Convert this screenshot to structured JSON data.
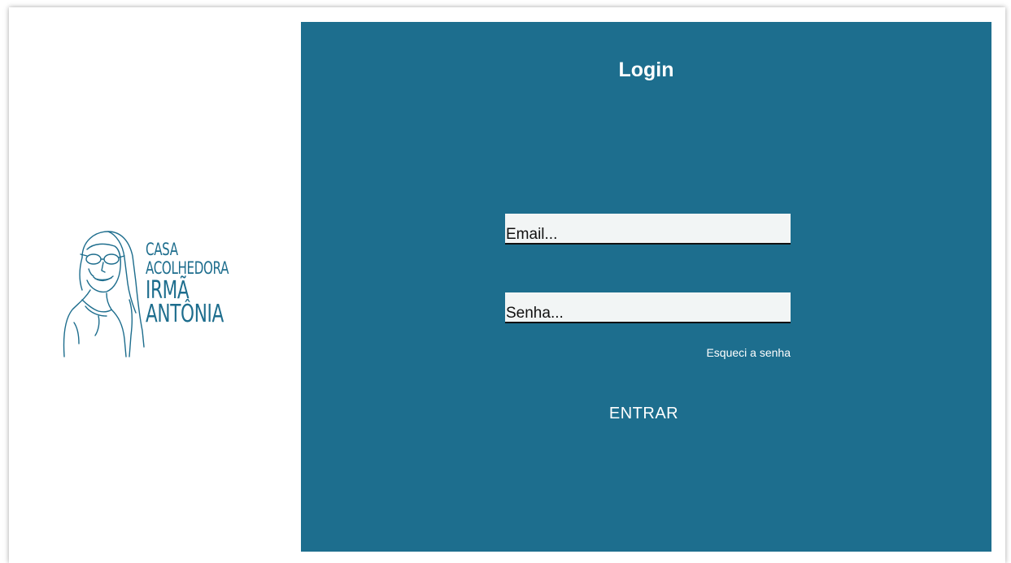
{
  "logo": {
    "line1": "CASA",
    "line2": "ACOLHEDORA",
    "line3": "IRMÃ",
    "line4": "ANTÔNIA",
    "color": "#1d6d8d"
  },
  "login": {
    "title": "Login",
    "email_placeholder": "Email...",
    "password_placeholder": "Senha...",
    "forgot_link": "Esqueci a senha",
    "submit_label": "ENTRAR",
    "panel_color": "#1d6e8e"
  }
}
